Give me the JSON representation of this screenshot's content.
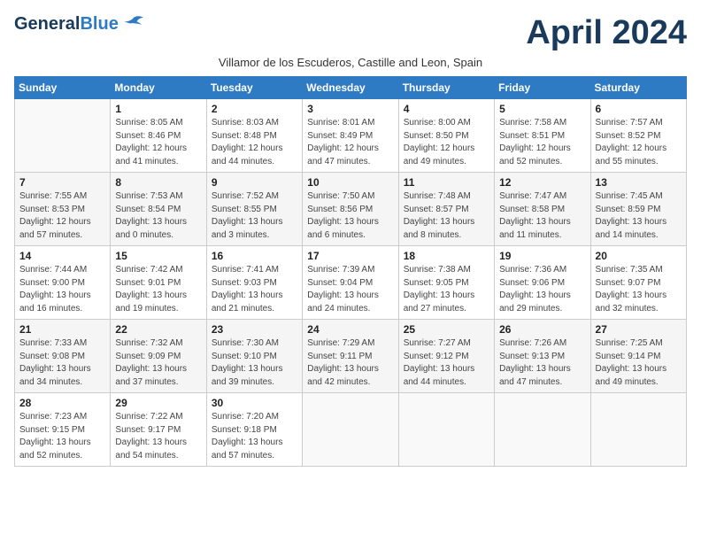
{
  "header": {
    "logo_general": "General",
    "logo_blue": "Blue",
    "month_title": "April 2024",
    "subtitle": "Villamor de los Escuderos, Castille and Leon, Spain"
  },
  "weekdays": [
    "Sunday",
    "Monday",
    "Tuesday",
    "Wednesday",
    "Thursday",
    "Friday",
    "Saturday"
  ],
  "weeks": [
    [
      {
        "day": "",
        "sunrise": "",
        "sunset": "",
        "daylight": ""
      },
      {
        "day": "1",
        "sunrise": "Sunrise: 8:05 AM",
        "sunset": "Sunset: 8:46 PM",
        "daylight": "Daylight: 12 hours and 41 minutes."
      },
      {
        "day": "2",
        "sunrise": "Sunrise: 8:03 AM",
        "sunset": "Sunset: 8:48 PM",
        "daylight": "Daylight: 12 hours and 44 minutes."
      },
      {
        "day": "3",
        "sunrise": "Sunrise: 8:01 AM",
        "sunset": "Sunset: 8:49 PM",
        "daylight": "Daylight: 12 hours and 47 minutes."
      },
      {
        "day": "4",
        "sunrise": "Sunrise: 8:00 AM",
        "sunset": "Sunset: 8:50 PM",
        "daylight": "Daylight: 12 hours and 49 minutes."
      },
      {
        "day": "5",
        "sunrise": "Sunrise: 7:58 AM",
        "sunset": "Sunset: 8:51 PM",
        "daylight": "Daylight: 12 hours and 52 minutes."
      },
      {
        "day": "6",
        "sunrise": "Sunrise: 7:57 AM",
        "sunset": "Sunset: 8:52 PM",
        "daylight": "Daylight: 12 hours and 55 minutes."
      }
    ],
    [
      {
        "day": "7",
        "sunrise": "Sunrise: 7:55 AM",
        "sunset": "Sunset: 8:53 PM",
        "daylight": "Daylight: 12 hours and 57 minutes."
      },
      {
        "day": "8",
        "sunrise": "Sunrise: 7:53 AM",
        "sunset": "Sunset: 8:54 PM",
        "daylight": "Daylight: 13 hours and 0 minutes."
      },
      {
        "day": "9",
        "sunrise": "Sunrise: 7:52 AM",
        "sunset": "Sunset: 8:55 PM",
        "daylight": "Daylight: 13 hours and 3 minutes."
      },
      {
        "day": "10",
        "sunrise": "Sunrise: 7:50 AM",
        "sunset": "Sunset: 8:56 PM",
        "daylight": "Daylight: 13 hours and 6 minutes."
      },
      {
        "day": "11",
        "sunrise": "Sunrise: 7:48 AM",
        "sunset": "Sunset: 8:57 PM",
        "daylight": "Daylight: 13 hours and 8 minutes."
      },
      {
        "day": "12",
        "sunrise": "Sunrise: 7:47 AM",
        "sunset": "Sunset: 8:58 PM",
        "daylight": "Daylight: 13 hours and 11 minutes."
      },
      {
        "day": "13",
        "sunrise": "Sunrise: 7:45 AM",
        "sunset": "Sunset: 8:59 PM",
        "daylight": "Daylight: 13 hours and 14 minutes."
      }
    ],
    [
      {
        "day": "14",
        "sunrise": "Sunrise: 7:44 AM",
        "sunset": "Sunset: 9:00 PM",
        "daylight": "Daylight: 13 hours and 16 minutes."
      },
      {
        "day": "15",
        "sunrise": "Sunrise: 7:42 AM",
        "sunset": "Sunset: 9:01 PM",
        "daylight": "Daylight: 13 hours and 19 minutes."
      },
      {
        "day": "16",
        "sunrise": "Sunrise: 7:41 AM",
        "sunset": "Sunset: 9:03 PM",
        "daylight": "Daylight: 13 hours and 21 minutes."
      },
      {
        "day": "17",
        "sunrise": "Sunrise: 7:39 AM",
        "sunset": "Sunset: 9:04 PM",
        "daylight": "Daylight: 13 hours and 24 minutes."
      },
      {
        "day": "18",
        "sunrise": "Sunrise: 7:38 AM",
        "sunset": "Sunset: 9:05 PM",
        "daylight": "Daylight: 13 hours and 27 minutes."
      },
      {
        "day": "19",
        "sunrise": "Sunrise: 7:36 AM",
        "sunset": "Sunset: 9:06 PM",
        "daylight": "Daylight: 13 hours and 29 minutes."
      },
      {
        "day": "20",
        "sunrise": "Sunrise: 7:35 AM",
        "sunset": "Sunset: 9:07 PM",
        "daylight": "Daylight: 13 hours and 32 minutes."
      }
    ],
    [
      {
        "day": "21",
        "sunrise": "Sunrise: 7:33 AM",
        "sunset": "Sunset: 9:08 PM",
        "daylight": "Daylight: 13 hours and 34 minutes."
      },
      {
        "day": "22",
        "sunrise": "Sunrise: 7:32 AM",
        "sunset": "Sunset: 9:09 PM",
        "daylight": "Daylight: 13 hours and 37 minutes."
      },
      {
        "day": "23",
        "sunrise": "Sunrise: 7:30 AM",
        "sunset": "Sunset: 9:10 PM",
        "daylight": "Daylight: 13 hours and 39 minutes."
      },
      {
        "day": "24",
        "sunrise": "Sunrise: 7:29 AM",
        "sunset": "Sunset: 9:11 PM",
        "daylight": "Daylight: 13 hours and 42 minutes."
      },
      {
        "day": "25",
        "sunrise": "Sunrise: 7:27 AM",
        "sunset": "Sunset: 9:12 PM",
        "daylight": "Daylight: 13 hours and 44 minutes."
      },
      {
        "day": "26",
        "sunrise": "Sunrise: 7:26 AM",
        "sunset": "Sunset: 9:13 PM",
        "daylight": "Daylight: 13 hours and 47 minutes."
      },
      {
        "day": "27",
        "sunrise": "Sunrise: 7:25 AM",
        "sunset": "Sunset: 9:14 PM",
        "daylight": "Daylight: 13 hours and 49 minutes."
      }
    ],
    [
      {
        "day": "28",
        "sunrise": "Sunrise: 7:23 AM",
        "sunset": "Sunset: 9:15 PM",
        "daylight": "Daylight: 13 hours and 52 minutes."
      },
      {
        "day": "29",
        "sunrise": "Sunrise: 7:22 AM",
        "sunset": "Sunset: 9:17 PM",
        "daylight": "Daylight: 13 hours and 54 minutes."
      },
      {
        "day": "30",
        "sunrise": "Sunrise: 7:20 AM",
        "sunset": "Sunset: 9:18 PM",
        "daylight": "Daylight: 13 hours and 57 minutes."
      },
      {
        "day": "",
        "sunrise": "",
        "sunset": "",
        "daylight": ""
      },
      {
        "day": "",
        "sunrise": "",
        "sunset": "",
        "daylight": ""
      },
      {
        "day": "",
        "sunrise": "",
        "sunset": "",
        "daylight": ""
      },
      {
        "day": "",
        "sunrise": "",
        "sunset": "",
        "daylight": ""
      }
    ]
  ]
}
